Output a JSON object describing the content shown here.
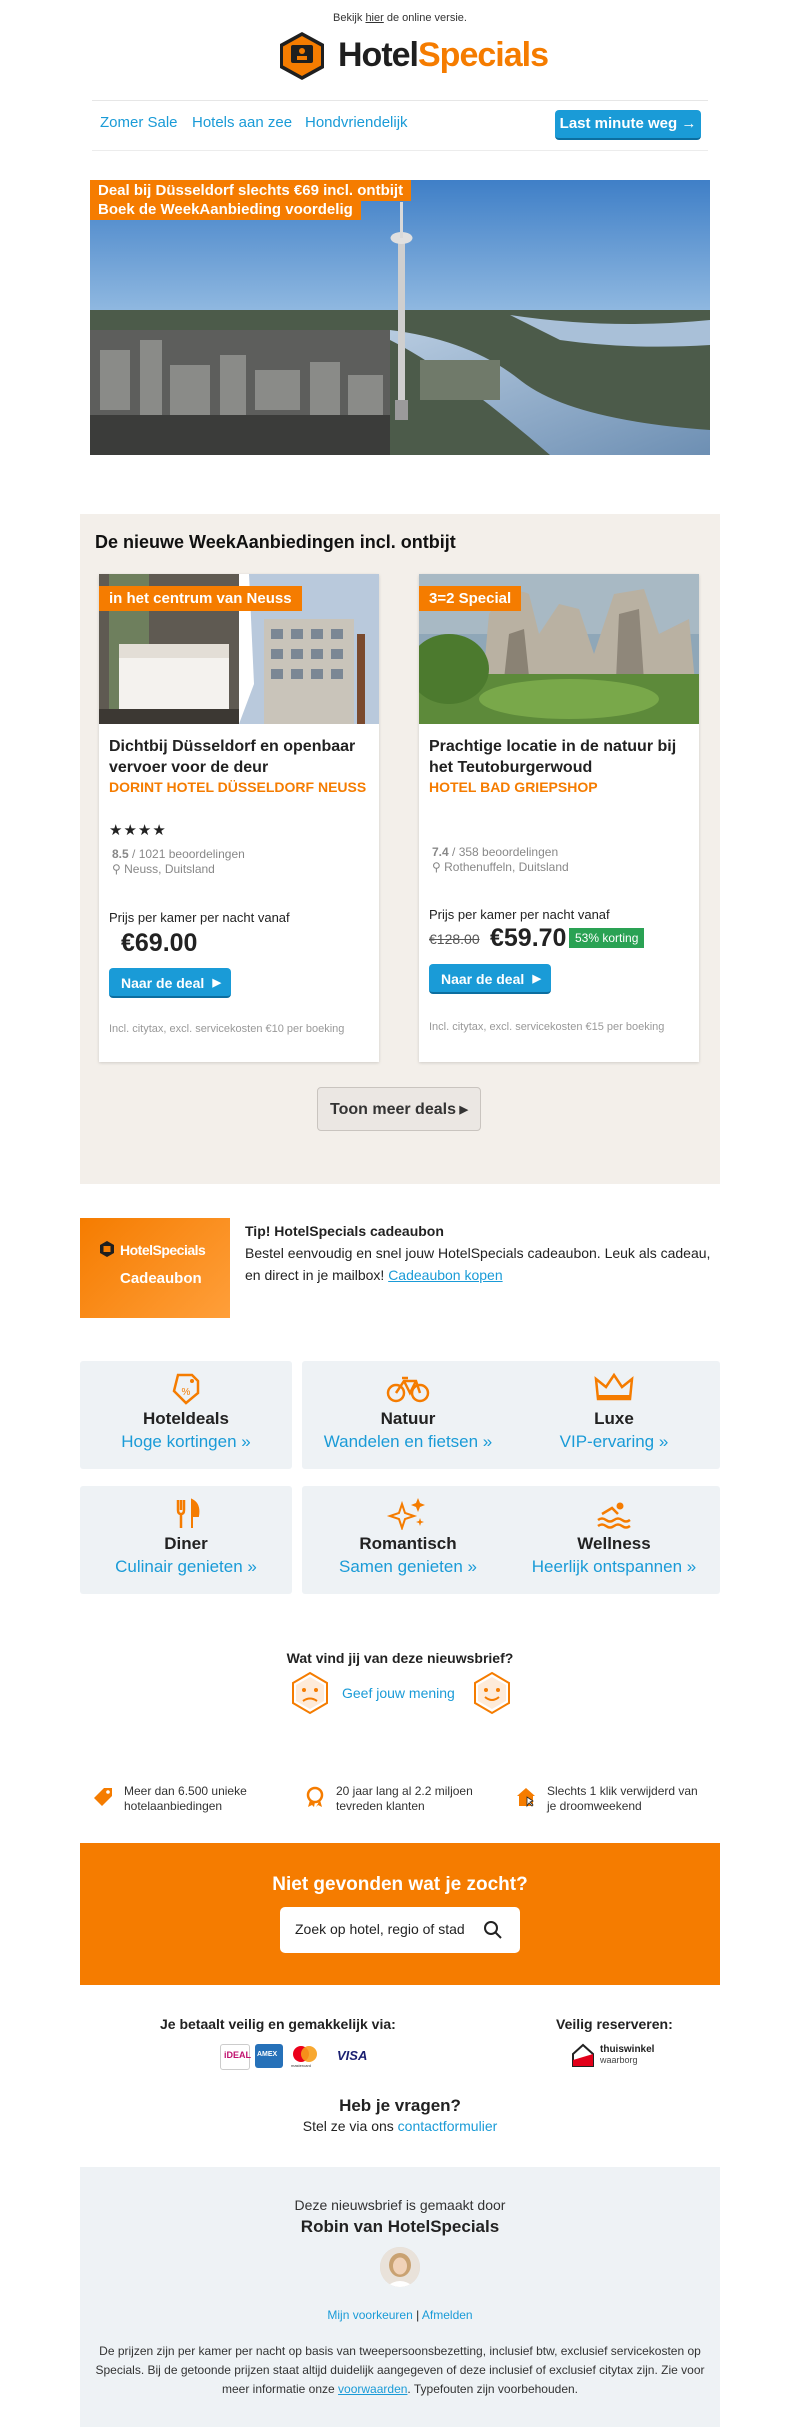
{
  "preheader": {
    "before": "Bekijk ",
    "link": "hier",
    "after": " de online versie."
  },
  "logo": {
    "part1": "Hotel",
    "part2": "Specials"
  },
  "nav": {
    "items": [
      "Zomer Sale",
      "Hotels aan zee",
      "Hondvriendelijk"
    ],
    "cta": "Last minute weg →"
  },
  "hero": {
    "line1": "Deal bij Düsseldorf slechts €69 incl. ontbijt",
    "line2": "Boek de WeekAanbieding voordelig"
  },
  "offers": {
    "heading": "De nieuwe WeekAanbiedingen incl. ontbijt",
    "cards": [
      {
        "badge": "in het centrum van Neuss",
        "title": "Dichtbij Düsseldorf en openbaar vervoer voor de deur",
        "hotel": "Dorint Hotel Düsseldorf Neuss",
        "stars": "★★★★",
        "score": "8.5",
        "reviews": " / 1021 beoordelingen",
        "location": "Neuss, Duitsland",
        "price_label": "Prijs per kamer per nacht vanaf",
        "price": "€69.00",
        "button": "Naar de deal",
        "fineprint": "Incl. citytax, excl. servicekosten €10 per boeking"
      },
      {
        "badge": "3=2 Special",
        "title": "Prachtige locatie in de natuur bij het Teutoburgerwoud",
        "hotel": "Hotel Bad Griepshop",
        "stars": "",
        "score": "7.4",
        "reviews": " / 358 beoordelingen",
        "location": "Rothenuffeln, Duitsland",
        "price_label": "Prijs per kamer per nacht vanaf",
        "old_price": "€128.00",
        "price": "€59.70",
        "discount": "53% korting",
        "button": "Naar de deal",
        "fineprint": "Incl. citytax, excl. servicekosten €15 per boeking"
      }
    ],
    "more_button": "Toon meer deals"
  },
  "gift": {
    "logo_text": "HotelSpecials",
    "label": "Cadeaubon",
    "title": "Tip! HotelSpecials cadeaubon",
    "text": "Bestel eenvoudig en snel jouw HotelSpecials cadeaubon. Leuk als cadeau, en direct in je mailbox! ",
    "link": "Cadeaubon kopen"
  },
  "categories": [
    {
      "icon": "price-tag-icon",
      "title": "Hoteldeals",
      "sub": "Hoge kortingen »"
    },
    {
      "icon": "bicycle-icon",
      "title": "Natuur",
      "sub": "Wandelen en fietsen »"
    },
    {
      "icon": "crown-icon",
      "title": "Luxe",
      "sub": "VIP-ervaring »"
    },
    {
      "icon": "cutlery-icon",
      "title": "Diner",
      "sub": "Culinair genieten »"
    },
    {
      "icon": "sparkles-icon",
      "title": "Romantisch",
      "sub": "Samen genieten »"
    },
    {
      "icon": "swimming-icon",
      "title": "Wellness",
      "sub": "Heerlijk ontspannen »"
    }
  ],
  "feedback": {
    "question": "Wat vind jij van deze nieuwsbrief?",
    "link": "Geef jouw mening"
  },
  "usps": [
    "Meer dan 6.500 unieke hotelaanbiedingen",
    "20 jaar lang al 2.2 miljoen tevreden klanten",
    "Slechts 1 klik verwijderd van je droomweekend"
  ],
  "search": {
    "question": "Niet gevonden wat je zocht?",
    "placeholder": "Zoek op hotel, regio of stad"
  },
  "payment": {
    "heading": "Je betaalt veilig en gemakkelijk via:",
    "methods": [
      "iDEAL",
      "AMEX",
      "mastercard",
      "VISA"
    ],
    "secure_heading": "Veilig reserveren:",
    "seal": "thuiswinkel",
    "seal_sub": "waarborg"
  },
  "questions": {
    "heading": "Heb je vragen?",
    "text": "Stel ze via ons ",
    "link": "contactformulier"
  },
  "footer": {
    "made_by": "Deze nieuwsbrief is gemaakt door",
    "author": "Robin van HotelSpecials",
    "pref_link": "Mijn voorkeuren",
    "unsub_link": "Afmelden",
    "disclaimer": "De prijzen zijn per kamer per nacht op basis van tweepersoonsbezetting, inclusief btw, exclusief servicekosten op Specials. Bij de getoonde prijzen staat altijd duidelijk aangegeven of deze inclusief of exclusief citytax zijn. Zie voor meer informatie onze ",
    "disclaimer_link": "voorwaarden",
    "disclaimer_end": ". Typefouten zijn voorbehouden."
  },
  "colors": {
    "brand_orange": "#f57c00",
    "link_blue": "#1a9bd7",
    "discount_green": "#2aa254"
  }
}
